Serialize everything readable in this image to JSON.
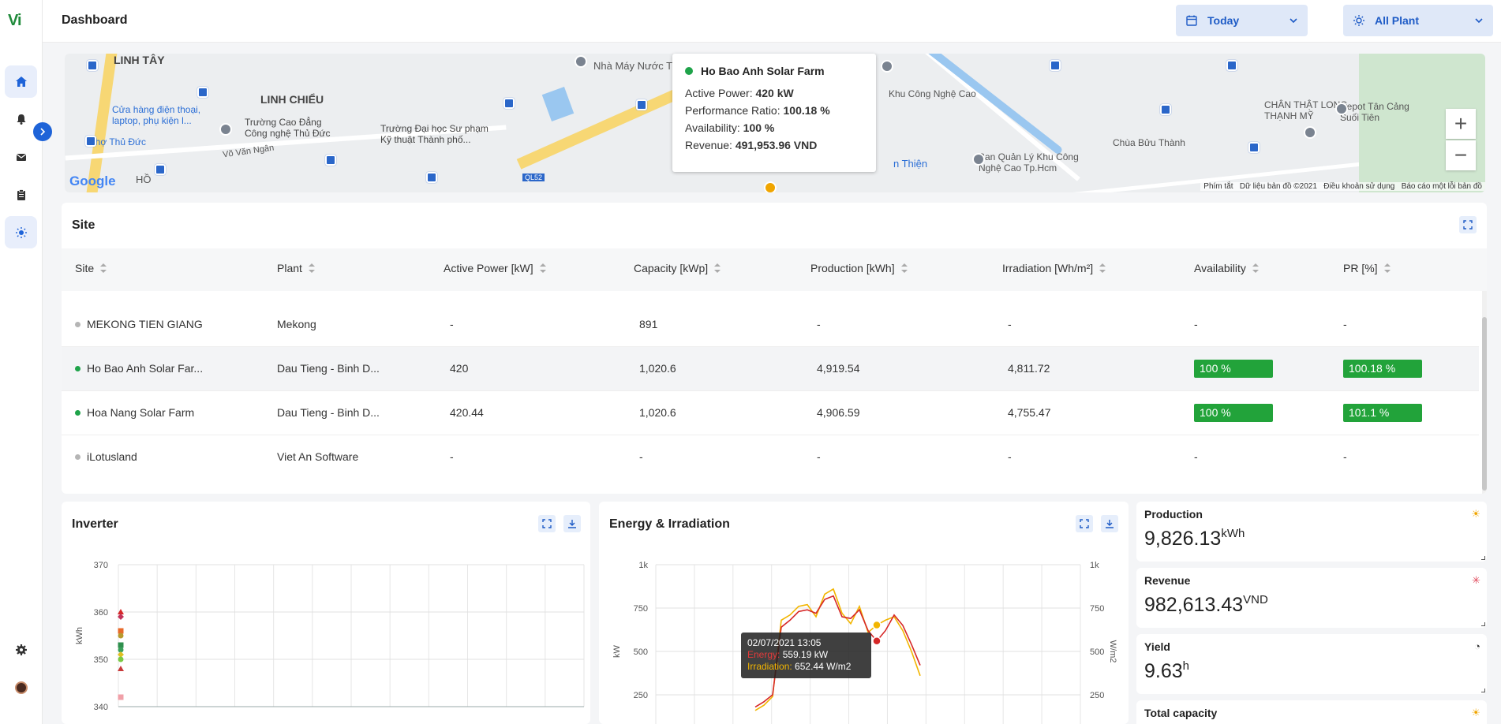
{
  "app": {
    "logo_text": "Vi",
    "page_title": "Dashboard"
  },
  "header": {
    "date_filter": "Today",
    "plant_filter": "All Plant"
  },
  "map": {
    "labels": {
      "linh_tay": "LINH TÂY",
      "linh_chieu": "LINH CHIỂU",
      "shop": "Cửa hàng điện thoại, laptop, phụ kiện l...",
      "school": "Trường Cao Đẳng Công nghệ Thủ Đức",
      "uni": "Trường Đại học Sư phạm Kỹ thuật Thành phố...",
      "market": "Chợ Thủ Đức",
      "water": "Nhà Máy Nước T",
      "industrial": "Khu Công Nghệ Cao",
      "temple": "Chùa Bửu Thành",
      "board": "Ban Quản Lý Khu Công Nghệ Cao Tp.Hcm",
      "chan_that": "CHÂN THẬT LONG THẠNH MỸ",
      "depot": "Depot Tân Cảng Suối Tiên",
      "van_ngan": "Võ Văn Ngân",
      "ho": "HỒ",
      "an_thien": "n Thiện",
      "ql52": "QL52",
      "google": "Google"
    },
    "footer": {
      "shortcuts": "Phím tắt",
      "data": "Dữ liệu bản đồ ©2021",
      "terms": "Điều khoản sử dụng",
      "report": "Báo cáo một lỗi bản đồ"
    },
    "tooltip": {
      "title": "Ho Bao Anh Solar Farm",
      "active_power_label": "Active Power:",
      "active_power_value": "420 kW",
      "pr_label": "Performance Ratio:",
      "pr_value": "100.18 %",
      "availability_label": "Availability:",
      "availability_value": "100 %",
      "revenue_label": "Revenue:",
      "revenue_value": "491,953.96 VND"
    },
    "zoom_in": "+",
    "zoom_out": "−"
  },
  "site": {
    "title": "Site",
    "columns": [
      "Site",
      "Plant",
      "Active Power [kW]",
      "Capacity [kWp]",
      "Production [kWh]",
      "Irradiation [Wh/m²]",
      "Availability",
      "PR [%]"
    ],
    "rows": [
      {
        "site": "MEKONG TIEN GIANG",
        "plant": "Mekong",
        "active_power": "-",
        "capacity": "891",
        "production": "-",
        "irradiation": "-",
        "availability": "-",
        "pr": "-",
        "status": "offline"
      },
      {
        "site": "Ho Bao Anh Solar Far...",
        "plant": "Dau Tieng - Binh D...",
        "active_power": "420",
        "capacity": "1,020.6",
        "production": "4,919.54",
        "irradiation": "4,811.72",
        "availability": "100 %",
        "pr": "100.18 %",
        "status": "online"
      },
      {
        "site": "Hoa Nang Solar Farm",
        "plant": "Dau Tieng - Binh D...",
        "active_power": "420.44",
        "capacity": "1,020.6",
        "production": "4,906.59",
        "irradiation": "4,755.47",
        "availability": "100 %",
        "pr": "101.1 %",
        "status": "online"
      },
      {
        "site": "iLotusland",
        "plant": "Viet An Software",
        "active_power": "-",
        "capacity": "-",
        "production": "-",
        "irradiation": "-",
        "availability": "-",
        "pr": "-",
        "status": "offline"
      }
    ]
  },
  "inverter": {
    "title": "Inverter",
    "ylabel": "kWh"
  },
  "energy": {
    "title": "Energy & Irradiation",
    "ylabel_left": "kW",
    "ylabel_right": "W/m2",
    "tooltip": {
      "time": "02/07/2021 13:05",
      "energy_label": "Energy:",
      "energy_value": "559.19 kW",
      "irr_label": "Irradiation:",
      "irr_value": "652.44 W/m2"
    }
  },
  "kpis": {
    "production": {
      "label": "Production",
      "value": "9,826.13",
      "unit": "kWh"
    },
    "revenue": {
      "label": "Revenue",
      "value": "982,613.43",
      "unit": "VND"
    },
    "yield": {
      "label": "Yield",
      "value": "9.63",
      "unit": "h"
    },
    "total_capacity": {
      "label": "Total capacity"
    }
  },
  "colors": {
    "accent": "#1e63d8",
    "online": "#1fa34a",
    "offline": "#b5b5b5",
    "badge": "#22a33a",
    "energy": "#d62828",
    "irradiation": "#f2b500"
  },
  "chart_data": [
    {
      "type": "scatter",
      "ylabel": "kWh",
      "ylim": [
        340,
        370
      ],
      "yticks": [
        370,
        360,
        350,
        340
      ],
      "x": [
        0,
        0,
        0,
        0,
        0,
        0,
        0,
        0,
        0,
        0
      ],
      "y": [
        360,
        359,
        356,
        355,
        353,
        352,
        351,
        350,
        348,
        342
      ]
    },
    {
      "type": "line",
      "ylim": [
        0,
        1000
      ],
      "yticks_left": [
        "1k",
        "750",
        "500",
        "250"
      ],
      "yticks_right": [
        "1k",
        "750",
        "500",
        "250"
      ],
      "series": [
        {
          "name": "Energy",
          "values": [
            180,
            210,
            250,
            640,
            680,
            730,
            740,
            720,
            800,
            820,
            700,
            690,
            740,
            620,
            560,
            620,
            710,
            650,
            540,
            420
          ]
        },
        {
          "name": "Irradiation",
          "values": [
            160,
            190,
            240,
            680,
            710,
            760,
            770,
            700,
            830,
            860,
            720,
            660,
            760,
            610,
            652,
            680,
            700,
            620,
            500,
            360
          ]
        }
      ]
    }
  ]
}
